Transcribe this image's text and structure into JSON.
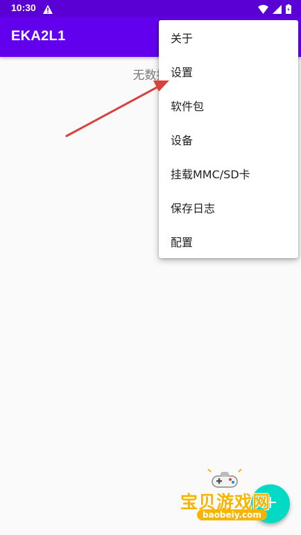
{
  "status_bar": {
    "time": "10:30",
    "icons": [
      "warning-icon",
      "wifi-icon",
      "signal-icon",
      "battery-icon"
    ]
  },
  "app_bar": {
    "title": "EKA2L1"
  },
  "main": {
    "empty_text": "无数据"
  },
  "overflow_menu": {
    "items": [
      {
        "label": "关于"
      },
      {
        "label": "设置"
      },
      {
        "label": "软件包"
      },
      {
        "label": "设备"
      },
      {
        "label": "挂载MMC/SD卡"
      },
      {
        "label": "保存日志"
      },
      {
        "label": "配置"
      }
    ]
  },
  "fab": {
    "icon": "add-icon"
  },
  "watermark": {
    "text": "宝贝游戏网",
    "url": "baobeiy.com"
  },
  "colors": {
    "status_bar": "#5b00d4",
    "app_bar": "#6200ee",
    "fab": "#03dac6",
    "annotation_arrow": "#d9413d",
    "watermark": "#f7b400"
  }
}
